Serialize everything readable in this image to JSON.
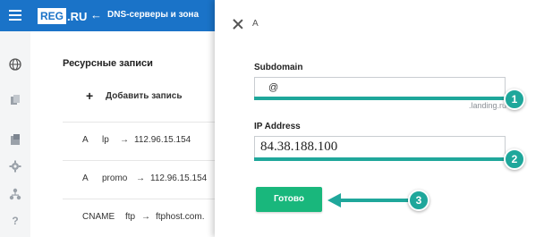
{
  "header": {
    "logo_box": "REG",
    "logo_suffix": ".RU",
    "back_arrow": "←",
    "title": "DNS-серверы и зона"
  },
  "rail_icons": [
    "globe-icon",
    "files-icon",
    "server-icon",
    "gear-icon",
    "network-icon",
    "help-icon"
  ],
  "panel": {
    "title": "Ресурсные записи",
    "add_plus": "+",
    "add_label": "Добавить запись",
    "records": [
      {
        "type": "A",
        "name": "lp",
        "arrow": "→",
        "target": "112.96.15.154"
      },
      {
        "type": "A",
        "name": "promo",
        "arrow": "→",
        "target": "112.96.15.154"
      },
      {
        "type": "CNAME",
        "name": "ftp",
        "arrow": "→",
        "target": "ftphost.com."
      }
    ]
  },
  "sheet": {
    "title": "A",
    "subdomain": {
      "label": "Subdomain",
      "value": "@",
      "hint": ".landing.ru"
    },
    "ip": {
      "label": "IP Address",
      "value": "84.38.188.100"
    },
    "done_label": "Готово",
    "badges": [
      "1",
      "2",
      "3"
    ]
  },
  "colors": {
    "header_blue": "#1a73c8",
    "highlight_teal": "#1fa79b",
    "button_green": "#19b77c"
  }
}
